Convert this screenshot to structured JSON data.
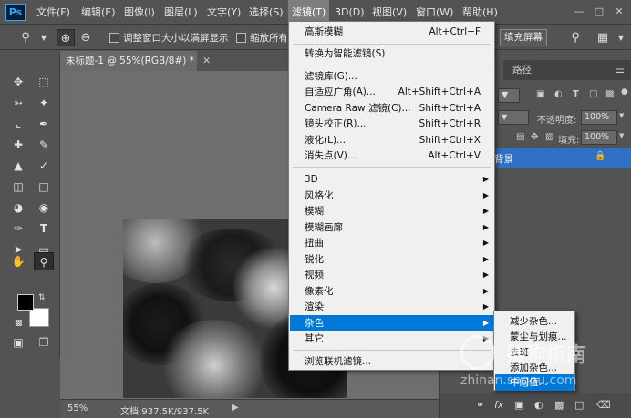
{
  "app": {
    "logo": "Ps",
    "brand_color": "#31a8ff"
  },
  "menubar": {
    "items": [
      "文件(F)",
      "编辑(E)",
      "图像(I)",
      "图层(L)",
      "文字(Y)",
      "选择(S)",
      "滤镜(T)",
      "3D(D)",
      "视图(V)",
      "窗口(W)",
      "帮助(H)"
    ],
    "active_index": 6,
    "window_controls": [
      "minimize-icon",
      "maximize-icon",
      "close-icon"
    ]
  },
  "options_bar": {
    "tool_icon": "zoom-icon",
    "zoom_in_icon": "zoom-in-icon",
    "zoom_out_icon": "zoom-out-icon",
    "resize_windows_label": "调整窗口大小以满屏显示",
    "zoom_all_label": "缩放所有窗口",
    "fill_screen_button": "填充屏幕",
    "right_icons": [
      "search-icon",
      "workspace-icon"
    ]
  },
  "toolbar": {
    "tools": [
      "move-icon",
      "marquee-icon",
      "lasso-icon",
      "magic-wand-icon",
      "crop-icon",
      "eyedropper-icon",
      "healing-icon",
      "brush-icon",
      "stamp-icon",
      "history-brush-icon",
      "eraser-icon",
      "gradient-icon",
      "blur-icon",
      "dodge-icon",
      "pen-icon",
      "type-icon",
      "path-select-icon",
      "shape-icon",
      "hand-icon",
      "zoom-icon"
    ],
    "active_tool": "zoom-icon",
    "foreground_color": "#000000",
    "background_color": "#ffffff"
  },
  "document": {
    "tab_title": "未标题-1 @ 55%(RGB/8#) *",
    "zoom": "55%",
    "doc_size": "文档:937.5K/937.5K"
  },
  "panel": {
    "tab_paths": "路径",
    "opacity_label": "不透明度:",
    "opacity_value": "100%",
    "fill_label": "填充:",
    "fill_value": "100%",
    "layer_name": "背景"
  },
  "filter_menu": {
    "groups": [
      [
        {
          "label": "高斯模糊",
          "shortcut": "Alt+Ctrl+F"
        }
      ],
      [
        {
          "label": "转换为智能滤镜(S)",
          "shortcut": ""
        }
      ],
      [
        {
          "label": "滤镜库(G)...",
          "shortcut": ""
        },
        {
          "label": "自适应广角(A)...",
          "shortcut": "Alt+Shift+Ctrl+A"
        },
        {
          "label": "Camera Raw 滤镜(C)...",
          "shortcut": "Shift+Ctrl+A"
        },
        {
          "label": "镜头校正(R)...",
          "shortcut": "Shift+Ctrl+R"
        },
        {
          "label": "液化(L)...",
          "shortcut": "Shift+Ctrl+X"
        },
        {
          "label": "消失点(V)...",
          "shortcut": "Alt+Ctrl+V"
        }
      ],
      [
        {
          "label": "3D",
          "submenu": true
        },
        {
          "label": "风格化",
          "submenu": true
        },
        {
          "label": "模糊",
          "submenu": true
        },
        {
          "label": "模糊画廊",
          "submenu": true
        },
        {
          "label": "扭曲",
          "submenu": true
        },
        {
          "label": "锐化",
          "submenu": true
        },
        {
          "label": "视频",
          "submenu": true
        },
        {
          "label": "像素化",
          "submenu": true
        },
        {
          "label": "渲染",
          "submenu": true
        },
        {
          "label": "杂色",
          "submenu": true,
          "highlighted": true
        },
        {
          "label": "其它",
          "submenu": true
        }
      ],
      [
        {
          "label": "浏览联机滤镜...",
          "shortcut": ""
        }
      ]
    ],
    "highlight_color": "#0078d7"
  },
  "noise_submenu": {
    "items": [
      "减少杂色...",
      "蒙尘与划痕...",
      "去斑",
      "添加杂色...",
      "中间值..."
    ],
    "highlighted_index": 4
  },
  "watermark": {
    "text": "搜狗指南",
    "url": "zhinan.sogou.com"
  }
}
